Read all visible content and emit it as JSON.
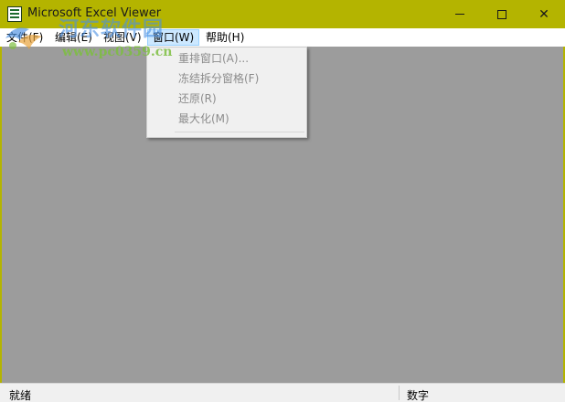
{
  "window": {
    "title": "Microsoft Excel Viewer",
    "titlebar_color": "#b4b400",
    "icon": "excel-viewer-icon",
    "controls": [
      "minimize-icon",
      "maximize-icon",
      "close-icon"
    ],
    "close_glyph": "✕"
  },
  "menubar": {
    "items": [
      {
        "label": "文件(F)"
      },
      {
        "label": "编辑(E)"
      },
      {
        "label": "视图(V)"
      },
      {
        "label": "窗口(W)",
        "active": true
      },
      {
        "label": "帮助(H)"
      }
    ]
  },
  "dropdown": {
    "parent": "窗口(W)",
    "items": [
      {
        "label": "重排窗口(A)...",
        "enabled": false
      },
      {
        "label": "冻结拆分窗格(F)",
        "enabled": false
      },
      {
        "label": "还原(R)",
        "enabled": false
      },
      {
        "label": "最大化(M)",
        "enabled": false
      }
    ]
  },
  "statusbar": {
    "left": "就绪",
    "right": "数字"
  },
  "watermark": {
    "name": "河东软件园",
    "url": "www.pc0359.cn"
  },
  "colors": {
    "workspace": "#9c9c9c",
    "menu_highlight": "#cce8ff",
    "disabled_text": "#8c8c8c"
  }
}
